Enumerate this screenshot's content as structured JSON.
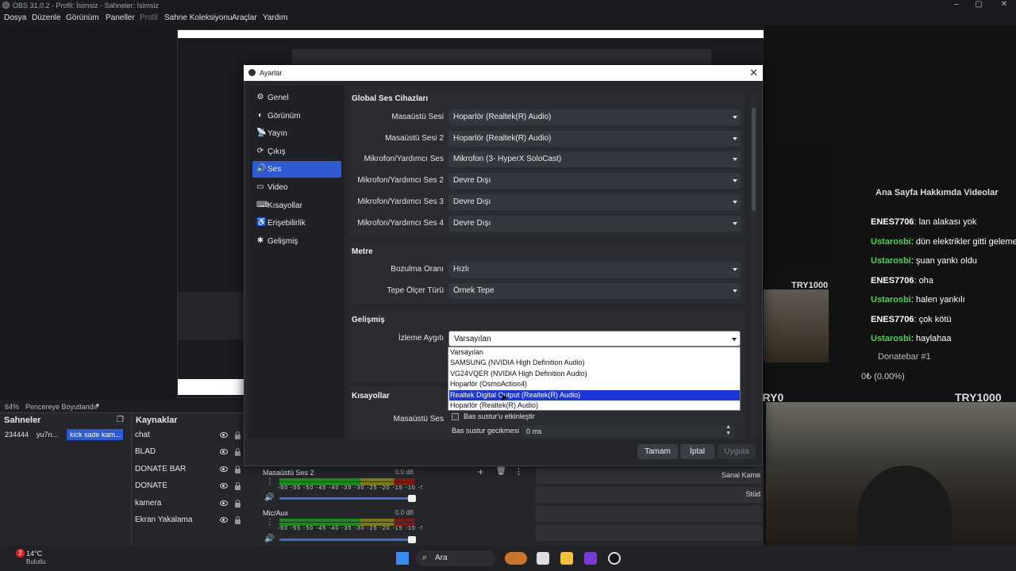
{
  "window": {
    "title": "OBS 31.0.2 - Profil: İsimsiz - Sahneler: İsimsiz"
  },
  "menu": [
    "Dosya",
    "Düzenle",
    "Görünüm",
    "Paneller",
    "Profil",
    "Sahne Koleksiyonu",
    "Araçlar",
    "Yardım"
  ],
  "status": {
    "zoom": "64%",
    "fit": "Pencereye Boyutlandır"
  },
  "scenes": {
    "title": "Sahneler",
    "items": [
      "234444",
      "yu7n...",
      "kick sade kam..."
    ]
  },
  "sources": {
    "title": "Kaynaklar",
    "items": [
      "chat",
      "BLAD",
      "DONATE BAR",
      "DONATE",
      "kamera",
      "Ekran Yakalama"
    ]
  },
  "mixer": {
    "channels": [
      {
        "name": "Masaüstü Ses 2",
        "db": "0.0 dB",
        "level": 0.55
      },
      {
        "name": "Mic/Aux",
        "db": "0.0 dB",
        "level": 0.6
      }
    ],
    "ticks": "-60 -55 -50 -45 -40 -35 -30 -25 -20 -15 -10 -5 0"
  },
  "controls": {
    "labels": [
      "Sanal Kame",
      "Stüd"
    ]
  },
  "chat": {
    "nav": "Ana Sayfa   Hakkımda   Videolar",
    "lines": [
      {
        "user": "ENES7706",
        "msg": "lan alakası yok",
        "color": "#ffffff"
      },
      {
        "user": "Ustarosbi",
        "msg": "dün elektrikler gitti geleme",
        "color": "#4fd15b"
      },
      {
        "user": "Ustarosbi",
        "msg": "şuan yankı oldu",
        "color": "#4fd15b"
      },
      {
        "user": "ENES7706",
        "msg": "oha",
        "color": "#ffffff"
      },
      {
        "user": "Ustarosbi",
        "msg": "halen yankılı",
        "color": "#4fd15b"
      },
      {
        "user": "ENES7706",
        "msg": "çok kötü",
        "color": "#ffffff"
      },
      {
        "user": "Ustarosbi",
        "msg": "haylahaa",
        "color": "#4fd15b"
      }
    ],
    "donate_title": "Donatebar #1",
    "donate_value": "0₺ (0.00%)",
    "try_labels": [
      "TRY1000",
      "TRY0",
      "TRY1000"
    ]
  },
  "settings": {
    "title": "Ayarlar",
    "nav": [
      {
        "label": "Genel",
        "icon": "⚙"
      },
      {
        "label": "Görünüm",
        "icon": "◐"
      },
      {
        "label": "Yayın",
        "icon": "📡"
      },
      {
        "label": "Çıkış",
        "icon": "⟳"
      },
      {
        "label": "Ses",
        "icon": "🔊"
      },
      {
        "label": "Video",
        "icon": "▭"
      },
      {
        "label": "Kısayollar",
        "icon": "⌨"
      },
      {
        "label": "Erişebilirlik",
        "icon": "♿"
      },
      {
        "label": "Gelişmiş",
        "icon": "✱"
      }
    ],
    "active_nav": "Ses",
    "global": {
      "title": "Global Ses Cihazları",
      "rows": [
        {
          "label": "Masaüstü Sesi",
          "value": "Hoparlör (Realtek(R) Audio)"
        },
        {
          "label": "Masaüstü Sesi 2",
          "value": "Hoparlör (Realtek(R) Audio)"
        },
        {
          "label": "Mikrofon/Yardımcı Ses",
          "value": "Mikrofon (3- HyperX SoloCast)"
        },
        {
          "label": "Mikrofon/Yardımcı Ses 2",
          "value": "Devre Dışı"
        },
        {
          "label": "Mikrofon/Yardımcı Ses 3",
          "value": "Devre Dışı"
        },
        {
          "label": "Mikrofon/Yardımcı Ses 4",
          "value": "Devre Dışı"
        }
      ]
    },
    "meter": {
      "title": "Metre",
      "rows": [
        {
          "label": "Bozulma Oranı",
          "value": "Hızlı"
        },
        {
          "label": "Tepe Ölçer Türü",
          "value": "Örnek Tepe"
        }
      ]
    },
    "advanced": {
      "title": "Gelişmiş",
      "monitor_label": "İzleme Aygıtı",
      "monitor_value": "Varsayılan",
      "options": [
        "Varsayılan",
        "SAMSUNG (NVIDIA High Definition Audio)",
        "VG24VQER (NVIDIA High Definition Audio)",
        "Hoparlör (OsmoAction4)",
        "Realtek Digital Output (Realtek(R) Audio)",
        "Hoparlör (Realtek(R) Audio)"
      ],
      "highlighted": 4
    },
    "hotkeys": {
      "title": "Kısayollar",
      "row_label": "Masaüstü Ses",
      "checkbox": "Bas sustur'u etkinleştir",
      "delay_label": "Bas sustur gecikmesi",
      "delay_value": "0 ms"
    },
    "buttons": {
      "ok": "Tamam",
      "cancel": "İptal",
      "apply": "Uygula"
    }
  },
  "taskbar": {
    "weather_temp": "14°C",
    "weather_text": "Bulutlu",
    "search": "Ara",
    "badge": "2"
  }
}
